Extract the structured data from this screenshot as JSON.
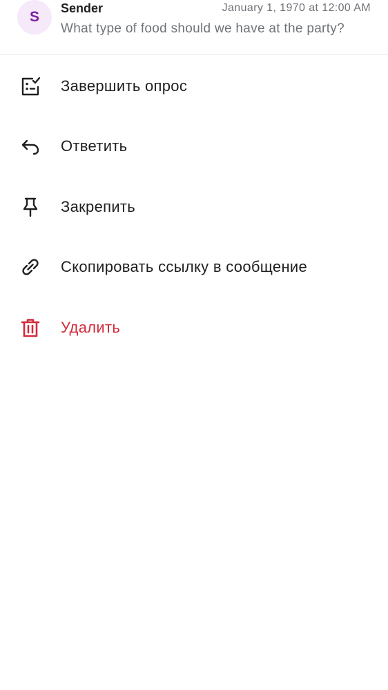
{
  "header": {
    "avatar_letter": "S",
    "sender": "Sender",
    "timestamp": "January 1, 1970 at 12:00 AM",
    "preview": "What type of food should we have at the party?"
  },
  "menu": {
    "items": [
      {
        "label": "Завершить опрос",
        "icon": "poll-checklist-icon"
      },
      {
        "label": "Ответить",
        "icon": "reply-icon"
      },
      {
        "label": "Закрепить",
        "icon": "pin-icon"
      },
      {
        "label": "Скопировать ссылку в сообщение",
        "icon": "link-icon"
      },
      {
        "label": "Удалить",
        "icon": "trash-icon"
      }
    ]
  },
  "colors": {
    "danger": "#d22a3a",
    "avatar_bg": "#f6e9f9",
    "avatar_text": "#7a1fa2",
    "secondary_text": "#6f7378"
  }
}
